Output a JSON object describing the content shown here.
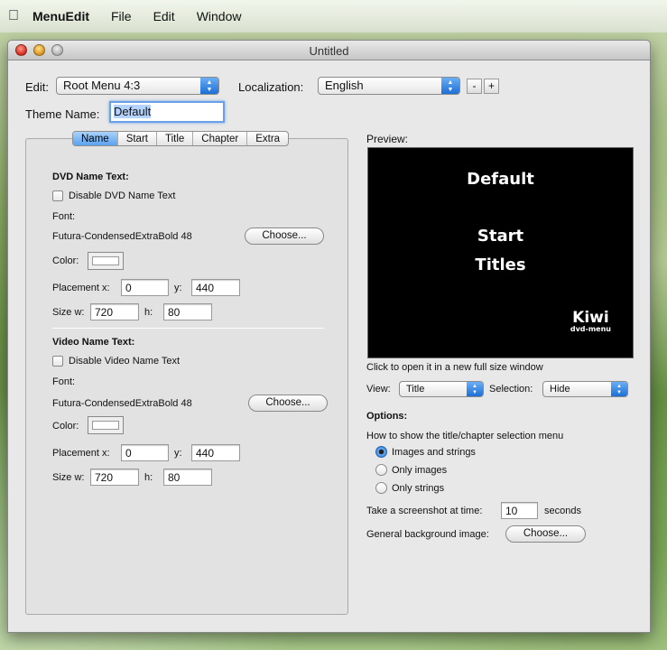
{
  "menubar": {
    "app": "MenuEdit",
    "items": [
      "File",
      "Edit",
      "Window"
    ]
  },
  "window": {
    "title": "Untitled"
  },
  "top": {
    "edit_label": "Edit:",
    "edit_value": "Root Menu 4:3",
    "localization_label": "Localization:",
    "localization_value": "English",
    "minus": "-",
    "plus": "+",
    "theme_label": "Theme Name:",
    "theme_value": "Default"
  },
  "tabs": [
    "Name",
    "Start",
    "Title",
    "Chapter",
    "Extra"
  ],
  "dvd": {
    "heading": "DVD Name Text:",
    "disable": "Disable DVD Name Text",
    "font_label": "Font:",
    "font_value": "Futura-CondensedExtraBold 48",
    "choose": "Choose...",
    "color_label": "Color:",
    "placement_label": "Placement x:",
    "x": "0",
    "y_label": "y:",
    "y": "440",
    "size_label": "Size w:",
    "w": "720",
    "h_label": "h:",
    "h": "80"
  },
  "video": {
    "heading": "Video Name Text:",
    "disable": "Disable Video Name Text",
    "font_label": "Font:",
    "font_value": "Futura-CondensedExtraBold 48",
    "choose": "Choose...",
    "color_label": "Color:",
    "placement_label": "Placement x:",
    "x": "0",
    "y_label": "y:",
    "y": "440",
    "size_label": "Size w:",
    "w": "720",
    "h_label": "h:",
    "h": "80"
  },
  "preview": {
    "label": "Preview:",
    "lines": [
      "Default",
      "Start",
      "Titles"
    ],
    "logo": "Kiwi",
    "logo_sub": "dvd-menu",
    "hint": "Click to open it in a new full size window",
    "view_label": "View:",
    "view_value": "Title",
    "selection_label": "Selection:",
    "selection_value": "Hide"
  },
  "options": {
    "heading": "Options:",
    "question": "How to show the title/chapter selection menu",
    "radios": [
      "Images and strings",
      "Only images",
      "Only strings"
    ],
    "selected_index": 0,
    "screenshot_label": "Take a screenshot at time:",
    "screenshot_value": "10",
    "screenshot_unit": "seconds",
    "bg_label": "General background image:",
    "bg_button": "Choose..."
  }
}
